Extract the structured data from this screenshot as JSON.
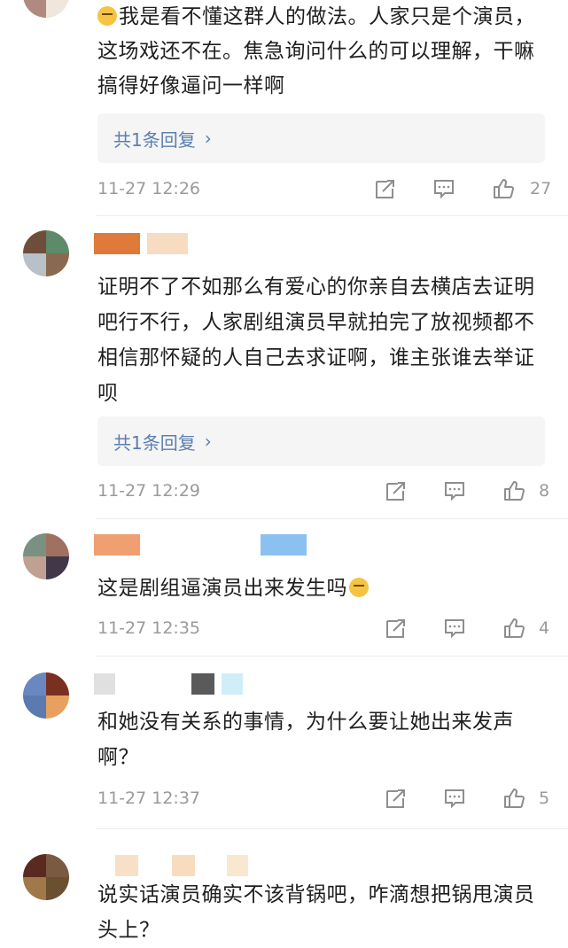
{
  "colors": {
    "link": "#5a7fb0",
    "meta": "#9a9a9a",
    "reply_bg": "#f5f5f5"
  },
  "comments": [
    {
      "text": "我是看不懂这群人的做法。人家只是个演员，这场戏还不在。焦急询问什么的可以理解，干嘛搞得好像逼问一样啊",
      "leading_emoji": "grimace-emoji",
      "reply_label": "共1条回复",
      "time": "11-27 12:26",
      "likes": "27"
    },
    {
      "text": "证明不了不如那么有爱心的你亲自去横店去证明吧行不行，人家剧组演员早就拍完了放视频都不相信那怀疑的人自己去求证啊，谁主张谁去举证呗",
      "reply_label": "共1条回复",
      "time": "11-27 12:29",
      "likes": "8"
    },
    {
      "text": "这是剧组逼演员出来发生吗",
      "trailing_emoji": "grimace-emoji",
      "time": "11-27 12:35",
      "likes": "4"
    },
    {
      "text": "和她没有关系的事情，为什么要让她出来发声啊？",
      "time": "11-27 12:37",
      "likes": "5"
    },
    {
      "text": "说实话演员确实不该背锅吧，咋滴想把锅甩演员头上？"
    }
  ]
}
